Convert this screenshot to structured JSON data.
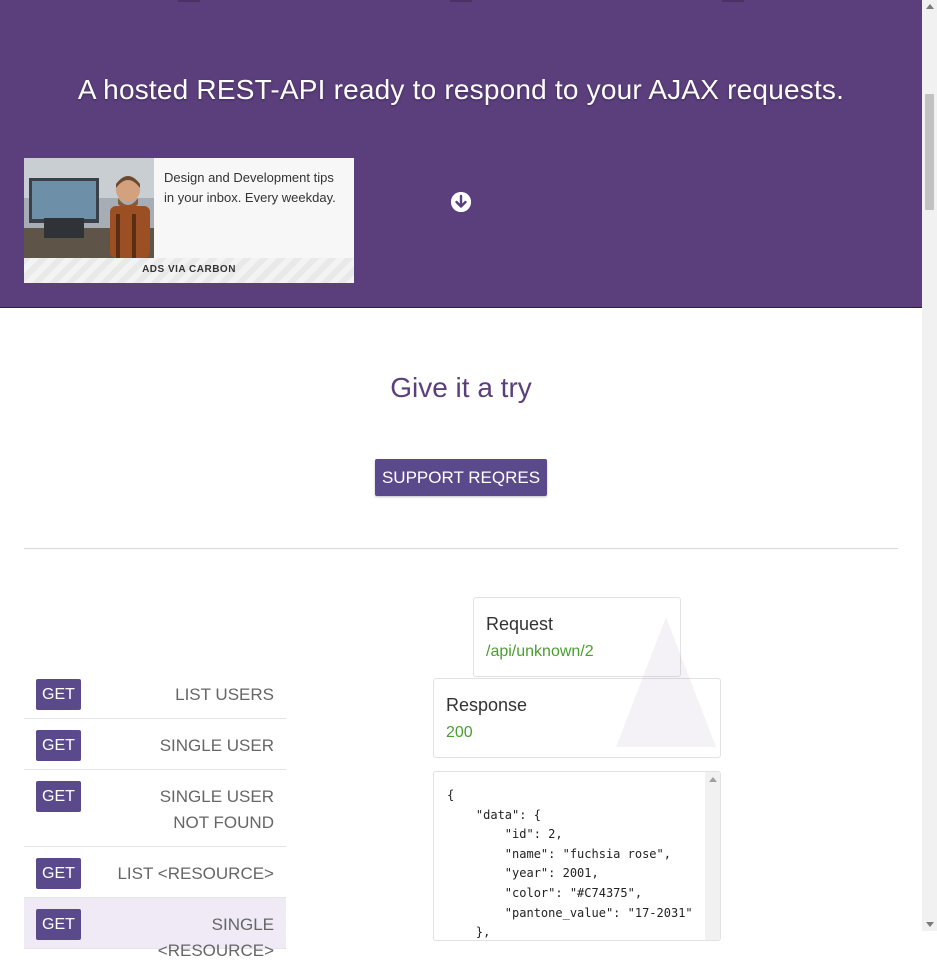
{
  "hero": {
    "tagline": "A hosted REST-API ready to respond to your AJAX requests.",
    "background_color": "#5b3e7c"
  },
  "ad": {
    "text": "Design and Development tips in your inbox. Every weekday.",
    "footer": "ADS VIA CARBON"
  },
  "try_section": {
    "title": "Give it a try",
    "support_button": "SUPPORT REQRES",
    "accent_color": "#5b4a8b"
  },
  "endpoints": [
    {
      "method": "GET",
      "label": "LIST USERS",
      "active": false
    },
    {
      "method": "GET",
      "label": "SINGLE USER",
      "active": false
    },
    {
      "method": "GET",
      "label": "SINGLE USER NOT FOUND",
      "active": false
    },
    {
      "method": "GET",
      "label": "LIST <RESOURCE>",
      "active": false
    },
    {
      "method": "GET",
      "label": "SINGLE <RESOURCE>",
      "active": true
    }
  ],
  "request": {
    "title": "Request",
    "url": "/api/unknown/2"
  },
  "response": {
    "title": "Response",
    "status": "200",
    "status_color": "#4a9e2f",
    "body": "{\n    \"data\": {\n        \"id\": 2,\n        \"name\": \"fuchsia rose\",\n        \"year\": 2001,\n        \"color\": \"#C74375\",\n        \"pantone_value\": \"17-2031\"\n    },"
  }
}
